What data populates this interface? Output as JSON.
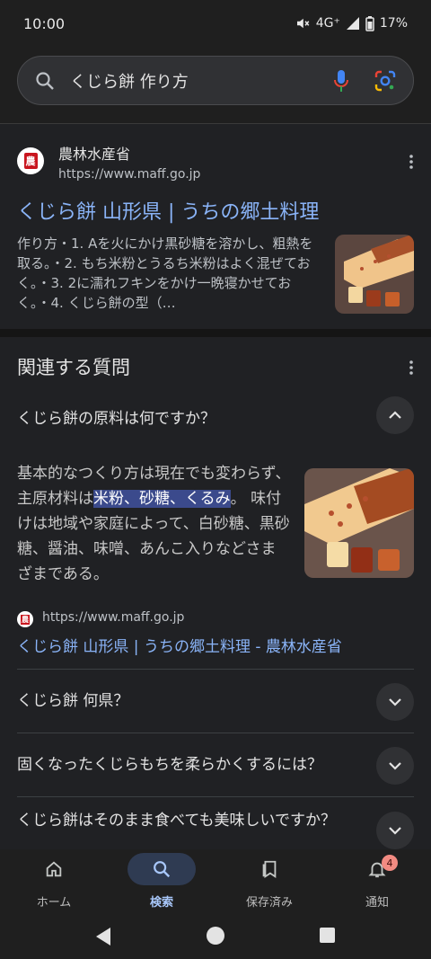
{
  "status": {
    "time": "10:00",
    "network": "4G⁺",
    "battery": "17%"
  },
  "search": {
    "query": "くじら餅 作り方"
  },
  "result": {
    "site_name": "農林水産省",
    "url": "https://www.maff.go.jp",
    "title": "くじら餅 山形県 | うちの郷土料理",
    "snippet": "作り方・1. Aを火にかけ黒砂糖を溶かし、粗熱を取る。・2. もち米粉とうるち米粉はよく混ぜておく。・3. 2に濡れフキンをかけ一晩寝かせておく。・4. くじら餅の型（…",
    "favicon_char": "農"
  },
  "paa": {
    "heading": "関連する質問",
    "open_question": "くじら餅の原料は何ですか？",
    "answer_pre": "基本的なつくり方は現在でも変わらず、主原材料は",
    "answer_highlight": "米粉、砂糖、くるみ",
    "answer_post": "。 味付けは地域や家庭によって、白砂糖、黒砂糖、醤油、味噌、あんこ入りなどさまざまである。",
    "source_url": "https://www.maff.go.jp",
    "source_title": "くじら餅 山形県 | うちの郷土料理 - 農林水産省",
    "questions": [
      "くじら餅 何県？",
      "固くなったくじらもちを柔らかくするには？",
      "くじら餅はそのまま食べても美味しいですか？"
    ]
  },
  "nav": {
    "home": "ホーム",
    "search": "検索",
    "saved": "保存済み",
    "notifications": "通知",
    "badge_count": "4"
  },
  "colors": {
    "link": "#8ab4f8",
    "highlight": "#3b4a8c",
    "active_tab": "#a8c7fa"
  }
}
